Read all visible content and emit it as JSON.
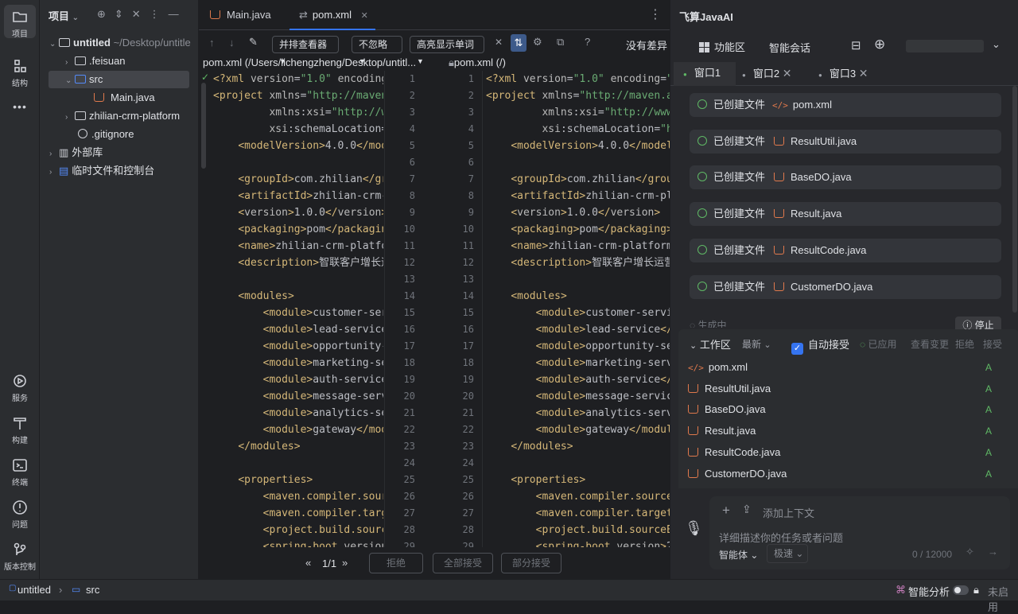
{
  "left_bar": {
    "items": [
      {
        "label": "项目",
        "icon": "folder-icon"
      },
      {
        "label": "结构",
        "icon": "structure-icon"
      },
      {
        "label": "服务",
        "icon": "services-icon"
      },
      {
        "label": "构建",
        "icon": "build-icon"
      },
      {
        "label": "终端",
        "icon": "terminal-icon"
      },
      {
        "label": "问题",
        "icon": "problems-icon"
      },
      {
        "label": "版本控制",
        "icon": "vcs-icon"
      }
    ],
    "more": "•••"
  },
  "project": {
    "title": "项目",
    "tree": [
      {
        "name": "untitled",
        "hint": "~/Desktop/untitle"
      },
      {
        "name": ".feisuan"
      },
      {
        "name": "src"
      },
      {
        "name": "Main.java"
      },
      {
        "name": "zhilian-crm-platform"
      },
      {
        "name": ".gitignore"
      },
      {
        "name": "外部库"
      },
      {
        "name": "临时文件和控制台"
      }
    ]
  },
  "editor": {
    "tabs": [
      {
        "label": "Main.java"
      },
      {
        "label": "pom.xml"
      }
    ],
    "toolbar": {
      "viewer": "并排查看器",
      "ignore": "不忽略",
      "highlight": "高亮显示单词",
      "no_diff": "没有差异",
      "help": "?"
    },
    "left_path": "pom.xml (/Users/lichengzheng/Desktop/untitl...",
    "right_path": "pom.xml (/)",
    "left_lines": [
      "<?xml version=\"1.0\" encoding=",
      "<project xmlns=\"http://maven.",
      "         xmlns:xsi=\"http://ww",
      "         xsi:schemaLocation=\"",
      "    <modelVersion>4.0.0</mode",
      "",
      "    <groupId>com.zhilian</grc",
      "    <artifactId>zhilian-crm-p",
      "    <version>1.0.0</version>",
      "    <packaging>pom</packaging",
      "    <name>zhilian-crm-platfor",
      "    <description>智联客户增长运",
      "",
      "    <modules>",
      "        <module>customer-serv",
      "        <module>lead-service<",
      "        <module>opportunity-s",
      "        <module>marketing-ser",
      "        <module>auth-service<",
      "        <module>message-servi",
      "        <module>analytics-ser",
      "        <module>gateway</modu",
      "    </modules>",
      "",
      "    <properties>",
      "        <maven.compiler.sourc",
      "        <maven.compiler.targe",
      "        <project.build.source",
      "        <spring-boot.version>"
    ],
    "right_lines": [
      "<?xml version=\"1.0\" encoding=\"U",
      "<project xmlns=\"http://maven.ap",
      "         xmlns:xsi=\"http://www.",
      "         xsi:schemaLocation=\"ht",
      "    <modelVersion>4.0.0</modelV",
      "",
      "    <groupId>com.zhilian</group",
      "    <artifactId>zhilian-crm-pla",
      "    <version>1.0.0</version>",
      "    <packaging>pom</packaging>",
      "    <name>zhilian-crm-platform<",
      "    <description>智联客户增长运营平",
      "",
      "    <modules>",
      "        <module>customer-servic",
      "        <module>lead-service</m",
      "        <module>opportunity-ser",
      "        <module>marketing-servi",
      "        <module>auth-service</m",
      "        <module>message-service",
      "        <module>analytics-servi",
      "        <module>gateway</module",
      "    </modules>",
      "",
      "    <properties>",
      "        <maven.compiler.source>",
      "        <maven.compiler.target>",
      "        <project.build.sourceEn",
      "        <spring-boot.version>2."
    ],
    "bottom": {
      "page": "1/1",
      "reject": "拒绝",
      "accept_all": "全部接受",
      "accept_part": "部分接受"
    }
  },
  "ai": {
    "title": "飞算JavaAI",
    "func_area": "功能区",
    "chat": "智能会话",
    "windows": [
      {
        "label": "窗口1"
      },
      {
        "label": "窗口2"
      },
      {
        "label": "窗口3"
      }
    ],
    "created_label": "已创建文件",
    "created_files": [
      "pom.xml",
      "ResultUtil.java",
      "BaseDO.java",
      "Result.java",
      "ResultCode.java",
      "CustomerDO.java"
    ],
    "generating": "生成中",
    "stop": "停止",
    "workspace": {
      "title": "工作区",
      "sort": "最新",
      "auto_accept": "自动接受",
      "applied": "已应用",
      "view_changes": "查看变更",
      "reject": "拒绝",
      "accept": "接受",
      "files": [
        {
          "name": "pom.xml",
          "status": "A"
        },
        {
          "name": "ResultUtil.java",
          "status": "A"
        },
        {
          "name": "BaseDO.java",
          "status": "A"
        },
        {
          "name": "Result.java",
          "status": "A"
        },
        {
          "name": "ResultCode.java",
          "status": "A"
        },
        {
          "name": "CustomerDO.java",
          "status": "A"
        }
      ]
    },
    "input": {
      "add_context": "添加上下文",
      "placeholder": "详细描述你的任务或者问题",
      "agent": "智能体",
      "speed": "极速",
      "count": "0 / 12000"
    }
  },
  "status": {
    "project": "untitled",
    "folder": "src",
    "smart": "智能分析",
    "lock": "未启用"
  }
}
